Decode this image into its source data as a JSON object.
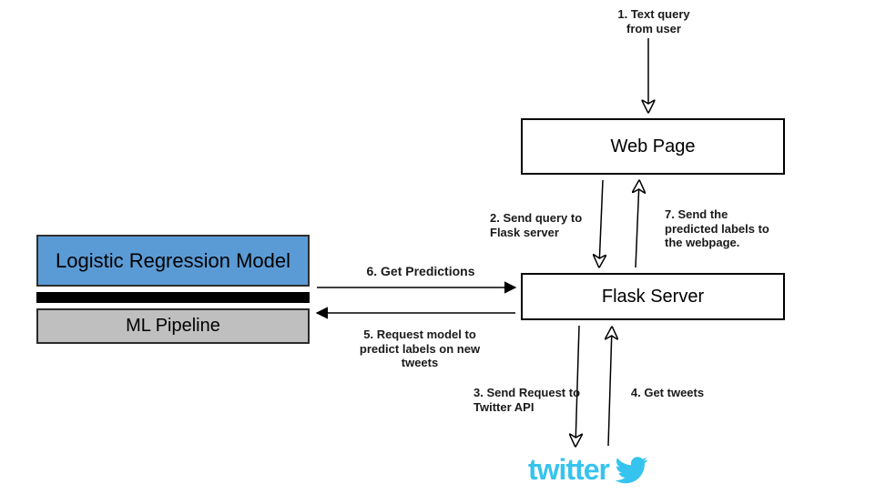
{
  "nodes": {
    "web_page": {
      "label": "Web Page"
    },
    "flask_server": {
      "label": "Flask Server"
    },
    "model_title": "Logistic Regression Model",
    "pipeline_title": "ML Pipeline",
    "twitter_text": "twitter"
  },
  "edges": {
    "step1": "1. Text query from user",
    "step2": "2. Send query to Flask  server",
    "step3": "3. Send Request to Twitter API",
    "step4": "4. Get tweets",
    "step5": "5. Request model to predict labels on new tweets",
    "step6": "6. Get Predictions",
    "step7": "7. Send the predicted labels to the webpage."
  },
  "colors": {
    "model_fill": "#5b9bd5",
    "pipeline_fill": "#bfbfbf",
    "twitter": "#36c4ee"
  }
}
